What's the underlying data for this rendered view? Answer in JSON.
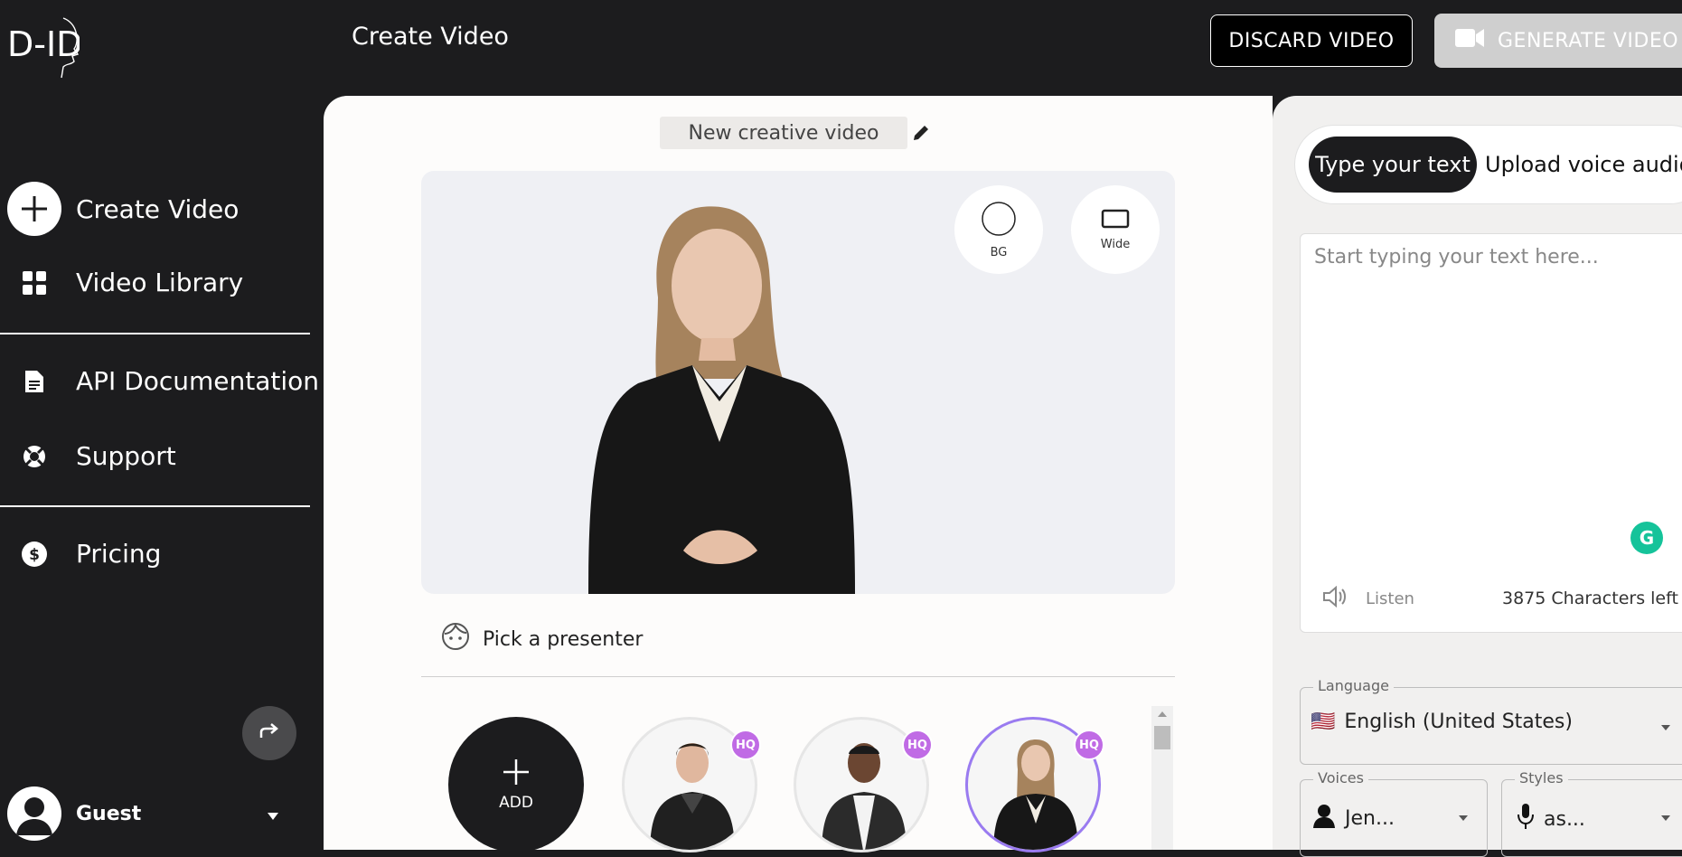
{
  "brand": {
    "logo_text": "D-ID"
  },
  "header": {
    "title": "Create Video",
    "discard_label": "DISCARD VIDEO",
    "generate_label": "GENERATE VIDEO"
  },
  "sidebar": {
    "items": [
      {
        "label": "Create Video",
        "icon": "plus-circle-icon"
      },
      {
        "label": "Video Library",
        "icon": "grid-icon"
      },
      {
        "label": "API Documentation",
        "icon": "document-icon"
      },
      {
        "label": "Support",
        "icon": "lifebuoy-icon"
      },
      {
        "label": "Pricing",
        "icon": "dollar-icon"
      }
    ],
    "user": {
      "name": "Guest"
    }
  },
  "editor": {
    "video_title": "New creative video",
    "bg_label": "BG",
    "wide_label": "Wide",
    "pick_presenter_label": "Pick a presenter",
    "add_label": "ADD",
    "presenters": [
      {
        "badge": "HQ",
        "selected": false
      },
      {
        "badge": "HQ",
        "selected": false
      },
      {
        "badge": "HQ",
        "selected": true
      }
    ]
  },
  "script_panel": {
    "tabs": [
      {
        "label": "Type your text",
        "active": true
      },
      {
        "label": "Upload voice audio",
        "active": false
      }
    ],
    "text_placeholder": "Start typing your text here...",
    "listen_label": "Listen",
    "characters_left": "3875 Characters left",
    "language": {
      "label": "Language",
      "value": "English (United States)",
      "flag": "🇺🇸"
    },
    "voices": {
      "label": "Voices",
      "value": "Jen..."
    },
    "styles": {
      "label": "Styles",
      "value": "as..."
    }
  },
  "colors": {
    "accent": "#c06be5",
    "dark": "#1c1c1e",
    "grammarly": "#15c39a"
  }
}
